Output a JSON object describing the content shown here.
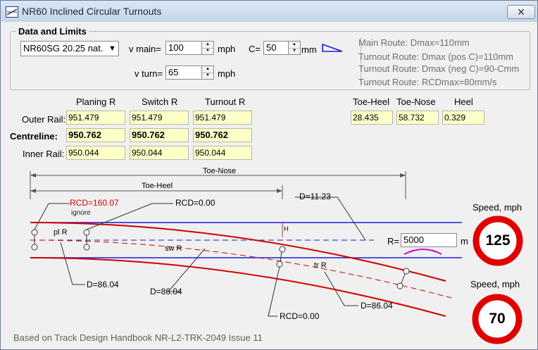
{
  "window": {
    "title": "NR60 Inclined Circular Turnouts",
    "close": "✕"
  },
  "group": {
    "title": "Data and Limits"
  },
  "combo": {
    "value": "NR60SG 20.25 nat.",
    "arrow": "▼"
  },
  "vmain": {
    "label": "v main=",
    "value": "100",
    "unit": "mph"
  },
  "vturn": {
    "label": "v turn=",
    "value": "65",
    "unit": "mph"
  },
  "cant": {
    "label": "C=",
    "value": "50",
    "unit": "mm"
  },
  "info": [
    "Main Route: Dmax=110mm",
    "Turnout Route: Dmax (pos C)=110mm",
    "Turnout Route: Dmax (neg C)=90-Cmm",
    "Turnout Route: RCDmax=80mm/s"
  ],
  "table": {
    "headers": [
      "Planing R",
      "Switch R",
      "Turnout R"
    ],
    "rows": [
      {
        "label": "Outer Rail:",
        "values": [
          "951.479",
          "951.479",
          "951.479"
        ]
      },
      {
        "label": "Centreline:",
        "values": [
          "950.762",
          "950.762",
          "950.762"
        ]
      },
      {
        "label": "Inner Rail:",
        "values": [
          "950.044",
          "950.044",
          "950.044"
        ]
      }
    ]
  },
  "toe": {
    "headers": [
      "Toe-Heel",
      "Toe-Nose",
      "Heel"
    ],
    "values": [
      "28.435",
      "58.732",
      "0.329"
    ]
  },
  "diagram": {
    "dim_toe_nose": "Toe-Nose",
    "dim_toe_heel": "Toe-Heel",
    "rcd_planing": "RCD=160.07",
    "ignore": "ignore",
    "rcd_switch": "RCD=0.00",
    "rcd_turnout": "RCD=0.00",
    "d_top": "D=11.23",
    "d_planing": "D=86.04",
    "d_switch": "D=86.04",
    "d_turnout": "D=86.04",
    "pl_r": "pl R",
    "sw_r": "sw R",
    "tr_r": "tr R",
    "h": "H",
    "r_label": "R=",
    "r_value": "5000",
    "r_unit": "m"
  },
  "speed_main": {
    "label": "Speed, mph",
    "value": "125"
  },
  "speed_turn": {
    "label": "Speed, mph",
    "value": "70"
  },
  "footer": "Based on Track Design Handbook NR-L2-TRK-2049 Issue 11",
  "colors": {
    "rail_blue": "#1c1cdc",
    "turnout_red": "#d20000",
    "sign_red": "#e00000",
    "cell_bg": "#ffffc8"
  }
}
